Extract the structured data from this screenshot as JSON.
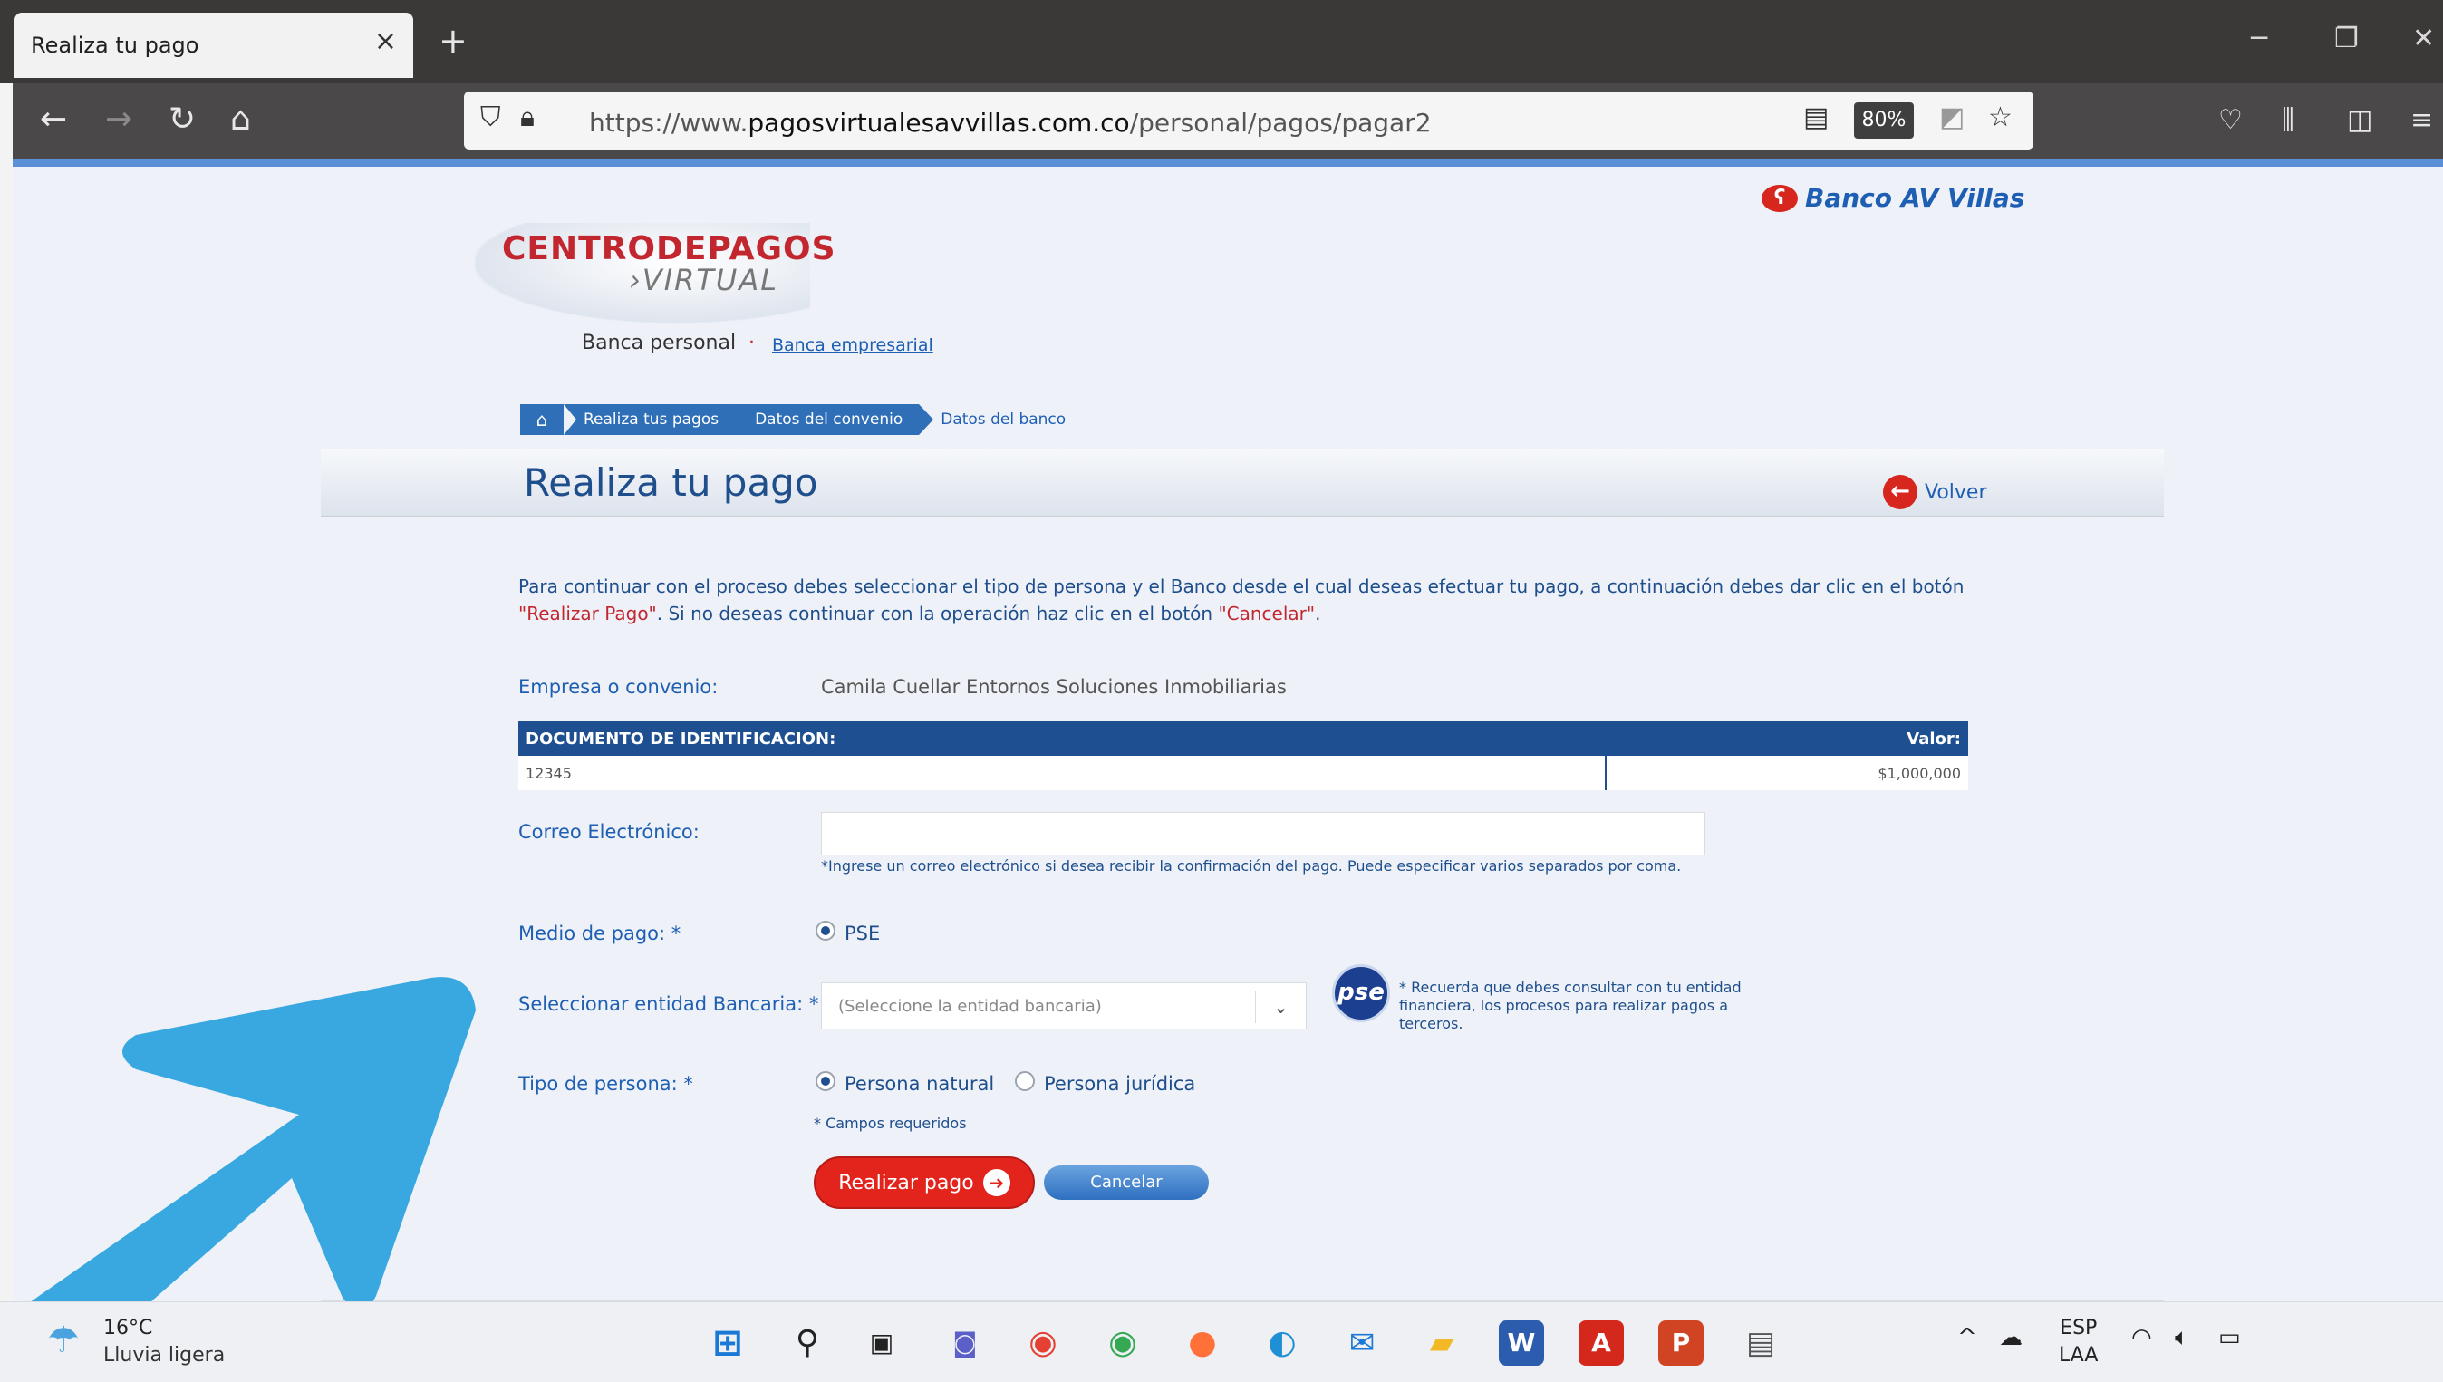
{
  "browser": {
    "tab_title": "Realiza tu pago",
    "tab_close": "×",
    "new_tab": "+",
    "url_prefix": "https://www.",
    "url_domain": "pagosvirtualesavvillas.com.co",
    "url_path": "/personal/pagos/pagar2",
    "zoom": "80%",
    "icons": [
      "back-icon",
      "forward-icon",
      "reload-icon",
      "home-icon",
      "shield-icon",
      "lock-icon",
      "reader-icon",
      "bookmark-star-icon",
      "pocket-icon",
      "library-icon",
      "sidebar-icon",
      "menu-icon"
    ]
  },
  "bank": {
    "name": "Banco AV Villas",
    "logo_top": "CENTRODEPAGOS",
    "logo_bottom": "›VIRTUAL",
    "nav_personal": "Banca personal",
    "nav_separator": "·",
    "nav_empresarial": "Banca empresarial"
  },
  "breadcrumb": {
    "items": [
      "Realiza tus pagos",
      "Datos del convenio"
    ],
    "current": "Datos del banco"
  },
  "page": {
    "title": "Realiza tu pago",
    "back_label": "Volver",
    "intro_a": "Para continuar con el proceso debes seleccionar el tipo de persona y el Banco desde el cual deseas efectuar tu pago, a continuación debes dar clic en el botón ",
    "intro_red1": "\"Realizar Pago\"",
    "intro_b": ". Si no deseas continuar con la operación haz clic en el botón ",
    "intro_red2": "\"Cancelar\"",
    "intro_c": "."
  },
  "form": {
    "empresa_label": "Empresa o convenio:",
    "empresa_value": "Camila Cuellar Entornos Soluciones Inmobiliarias",
    "table": {
      "headers": [
        "DOCUMENTO DE IDENTIFICACION:",
        "Valor:"
      ],
      "rows": [
        [
          "12345",
          "$1,000,000"
        ]
      ]
    },
    "email_label": "Correo Electrónico:",
    "email_value": "",
    "email_hint": "*Ingrese un correo electrónico si desea recibir la confirmación del pago. Puede especificar varios separados por coma.",
    "medio_label": "Medio de pago: *",
    "medio_option": "PSE",
    "entidad_label": "Seleccionar entidad Bancaria: *",
    "entidad_placeholder": "(Seleccione la entidad bancaria)",
    "pse_logo": "pse",
    "pse_note": "* Recuerda que debes consultar con tu entidad financiera,  los procesos para realizar pagos a terceros.",
    "tipo_label": "Tipo de persona: *",
    "tipo_options": [
      "Persona natural",
      "Persona jurídica"
    ],
    "tipo_selected": "Persona natural",
    "required_note": "* Campos requeridos",
    "btn_pagar": "Realizar pago",
    "btn_cancelar": "Cancelar"
  },
  "taskbar": {
    "weather_temp": "16°C",
    "weather_desc": "Lluvia ligera",
    "lang_top": "ESP",
    "lang_bottom": "LAA",
    "apps": [
      "windows-start",
      "search",
      "task-view",
      "teams-chat",
      "chrome",
      "chrome-profile",
      "firefox",
      "edge",
      "mail",
      "file-explorer",
      "word",
      "acrobat",
      "powerpoint",
      "notepad"
    ]
  },
  "colors": {
    "brand_red": "#c2262e",
    "brand_blue": "#1f5fb3",
    "table_header": "#1d4f91",
    "annotation_arrow": "#3aa8e0"
  }
}
